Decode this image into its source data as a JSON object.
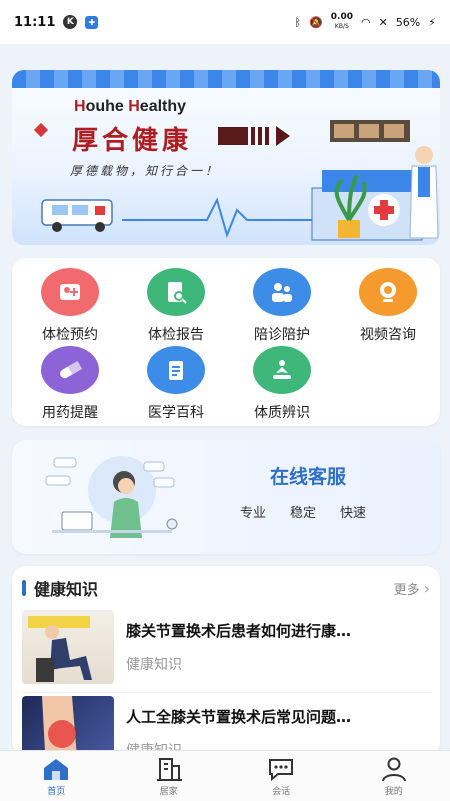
{
  "status_bar": {
    "time": "11:11",
    "badge_k": "K",
    "network_speed": "0.00",
    "network_unit": "KB/S",
    "battery": "56%"
  },
  "banner": {
    "brand_en_prefix_h1": "H",
    "brand_en_rest1": "ouhe ",
    "brand_en_prefix_h2": "H",
    "brand_en_rest2": "ealthy",
    "brand_cn": "厚合健康",
    "slogan": "厚德载物，知行合一！"
  },
  "services": [
    {
      "label": "体检预约",
      "icon": "clinic-user-icon",
      "color": "#f06a6e"
    },
    {
      "label": "体检报告",
      "icon": "report-search-icon",
      "color": "#3fb67a"
    },
    {
      "label": "陪诊陪护",
      "icon": "companion-icon",
      "color": "#3d8de8"
    },
    {
      "label": "视频咨询",
      "icon": "video-camera-icon",
      "color": "#f59a2c"
    },
    {
      "label": "用药提醒",
      "icon": "pill-icon",
      "color": "#8d63d8"
    },
    {
      "label": "医学百科",
      "icon": "clipboard-icon",
      "color": "#3d8de8"
    },
    {
      "label": "体质辨识",
      "icon": "meditation-icon",
      "color": "#3fb67a"
    }
  ],
  "customer_service": {
    "title": "在线客服",
    "tags": [
      "专业",
      "稳定",
      "快速"
    ]
  },
  "knowledge": {
    "title": "健康知识",
    "more": "更多",
    "articles": [
      {
        "title": "膝关节置换术后患者如何进行康…",
        "category": "健康知识"
      },
      {
        "title": "人工全膝关节置换术后常见问题…",
        "category": "健康知识"
      }
    ]
  },
  "tabbar": [
    {
      "label": "首页",
      "icon": "home-icon",
      "active": true
    },
    {
      "label": "居家",
      "icon": "building-icon",
      "active": false
    },
    {
      "label": "会话",
      "icon": "chat-icon",
      "active": false
    },
    {
      "label": "我的",
      "icon": "user-icon",
      "active": false
    }
  ]
}
